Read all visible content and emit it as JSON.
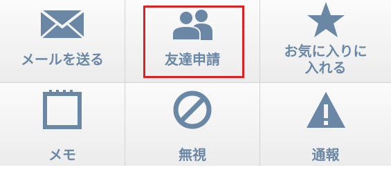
{
  "menu": {
    "items": [
      {
        "label": "メールを送る",
        "icon": "envelope-icon"
      },
      {
        "label": "友達申請",
        "icon": "people-icon",
        "highlighted": true
      },
      {
        "label": "お気に入りに\n入れる",
        "icon": "star-icon"
      },
      {
        "label": "メモ",
        "icon": "notepad-icon"
      },
      {
        "label": "無視",
        "icon": "block-icon"
      },
      {
        "label": "通報",
        "icon": "warning-icon"
      }
    ]
  },
  "colors": {
    "icon": "#6a87a6",
    "label": "#6a87a6",
    "highlight_border": "#e02020"
  }
}
